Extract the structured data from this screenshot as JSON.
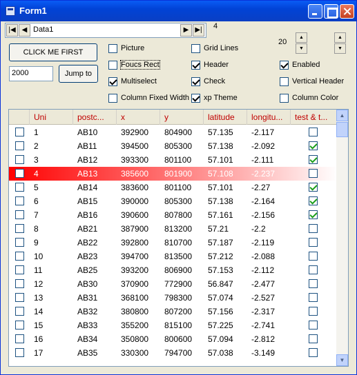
{
  "window": {
    "title": "Form1"
  },
  "nav": {
    "text": "Data1",
    "count": "4",
    "first": "|◀",
    "prev": "◀",
    "next": "▶",
    "last": "▶|"
  },
  "buttons": {
    "click_first": "CLICK ME FIRST",
    "jump": "Jump to"
  },
  "jump_value": "2000",
  "spin_value": "20",
  "options": {
    "picture": "Picture",
    "focus_rect": "Foucs Rect",
    "multiselect": "Multiselect",
    "column_fixed_width": "Column Fixed Width",
    "grid_lines": "Grid Lines",
    "header": "Header",
    "check": "Check",
    "xp_theme": "xp Theme",
    "enabled": "Enabled",
    "vertical_header": "Vertical Header",
    "column_color": "Column Color"
  },
  "grid": {
    "columns": [
      "Uni",
      "postc...",
      "x",
      "y",
      "latitude",
      "longitu...",
      "test & t..."
    ],
    "rows": [
      {
        "uni": "1",
        "postc": "AB10",
        "x": "392900",
        "y": "804900",
        "lat": "57.135",
        "lon": "-2.117",
        "test": false
      },
      {
        "uni": "2",
        "postc": "AB11",
        "x": "394500",
        "y": "805300",
        "lat": "57.138",
        "lon": "-2.092",
        "test": true
      },
      {
        "uni": "3",
        "postc": "AB12",
        "x": "393300",
        "y": "801100",
        "lat": "57.101",
        "lon": "-2.111",
        "test": true
      },
      {
        "uni": "4",
        "postc": "AB13",
        "x": "385600",
        "y": "801900",
        "lat": "57.108",
        "lon": "-2.237",
        "test": false
      },
      {
        "uni": "5",
        "postc": "AB14",
        "x": "383600",
        "y": "801100",
        "lat": "57.101",
        "lon": "-2.27",
        "test": true
      },
      {
        "uni": "6",
        "postc": "AB15",
        "x": "390000",
        "y": "805300",
        "lat": "57.138",
        "lon": "-2.164",
        "test": true
      },
      {
        "uni": "7",
        "postc": "AB16",
        "x": "390600",
        "y": "807800",
        "lat": "57.161",
        "lon": "-2.156",
        "test": true
      },
      {
        "uni": "8",
        "postc": "AB21",
        "x": "387900",
        "y": "813200",
        "lat": "57.21",
        "lon": "-2.2",
        "test": false
      },
      {
        "uni": "9",
        "postc": "AB22",
        "x": "392800",
        "y": "810700",
        "lat": "57.187",
        "lon": "-2.119",
        "test": false
      },
      {
        "uni": "10",
        "postc": "AB23",
        "x": "394700",
        "y": "813500",
        "lat": "57.212",
        "lon": "-2.088",
        "test": false
      },
      {
        "uni": "11",
        "postc": "AB25",
        "x": "393200",
        "y": "806900",
        "lat": "57.153",
        "lon": "-2.112",
        "test": false
      },
      {
        "uni": "12",
        "postc": "AB30",
        "x": "370900",
        "y": "772900",
        "lat": "56.847",
        "lon": "-2.477",
        "test": false
      },
      {
        "uni": "13",
        "postc": "AB31",
        "x": "368100",
        "y": "798300",
        "lat": "57.074",
        "lon": "-2.527",
        "test": false
      },
      {
        "uni": "14",
        "postc": "AB32",
        "x": "380800",
        "y": "807200",
        "lat": "57.156",
        "lon": "-2.317",
        "test": false
      },
      {
        "uni": "15",
        "postc": "AB33",
        "x": "355200",
        "y": "815100",
        "lat": "57.225",
        "lon": "-2.741",
        "test": false
      },
      {
        "uni": "16",
        "postc": "AB34",
        "x": "350800",
        "y": "800600",
        "lat": "57.094",
        "lon": "-2.812",
        "test": false
      },
      {
        "uni": "17",
        "postc": "AB35",
        "x": "330300",
        "y": "794700",
        "lat": "57.038",
        "lon": "-3.149",
        "test": false
      }
    ]
  },
  "colors": {
    "header_text": "#c00000",
    "selected_row": "#ff0000",
    "check_mark": "#1b9e1b"
  }
}
